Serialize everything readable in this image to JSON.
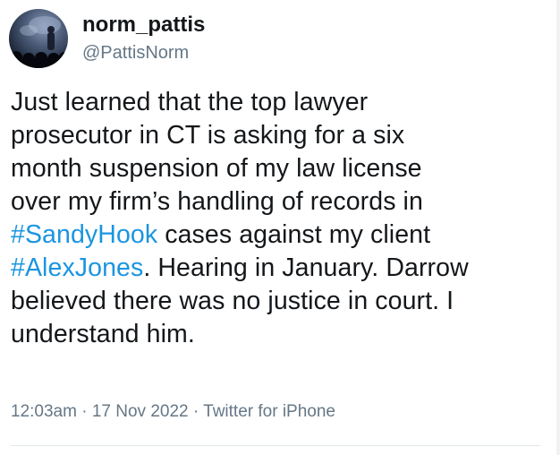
{
  "user": {
    "display_name": "norm_pattis",
    "handle": "@PattisNorm"
  },
  "tweet": {
    "text_1": "Just learned that the top lawyer\nprosecutor in CT is asking for a six\nmonth suspension of my law license\nover my firm’s handling of records in\n",
    "hashtag_1": "#SandyHook",
    "text_2": " cases against my client\n",
    "hashtag_2": "#AlexJones",
    "text_3": ". Hearing in January. Darrow\nbelieved there was no justice in court. I\nunderstand him."
  },
  "meta": {
    "time": "12:03am",
    "separator_1": " · ",
    "date": "17 Nov 2022",
    "separator_2": " · ",
    "source": "Twitter for iPhone"
  },
  "colors": {
    "hashtag": "#1b95e0",
    "secondary_text": "#657786",
    "primary_text": "#14171a"
  }
}
